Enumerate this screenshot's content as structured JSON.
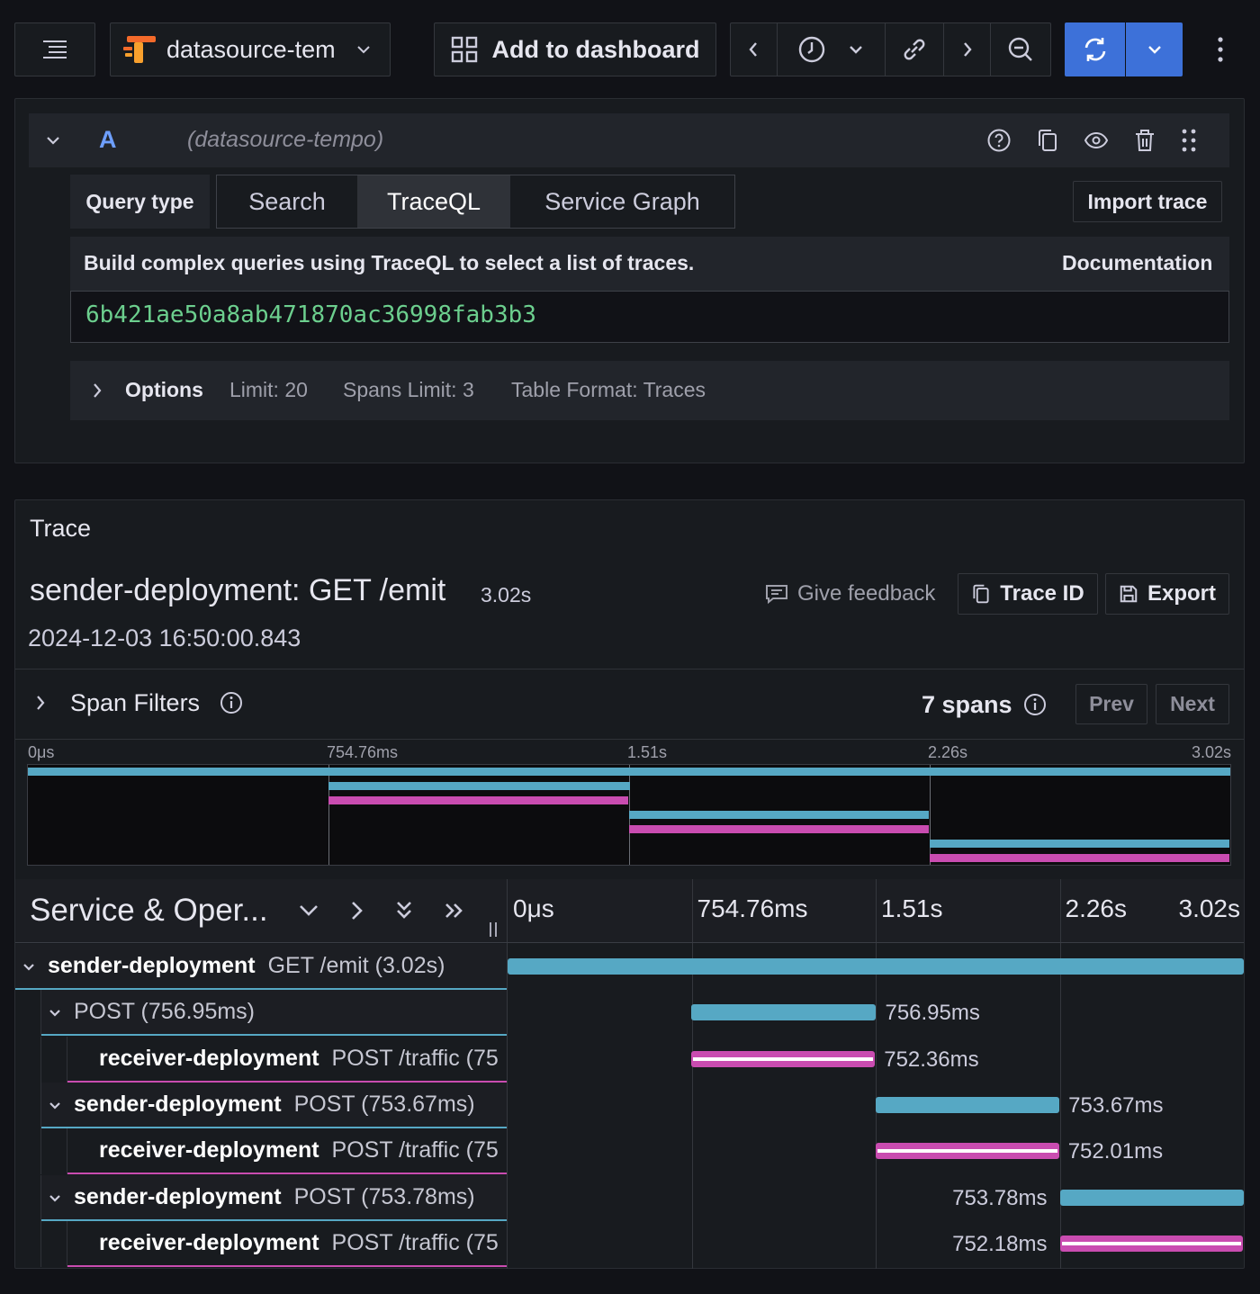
{
  "toolbar": {
    "datasource_name": "datasource-tem",
    "add_to_dashboard": "Add to dashboard"
  },
  "query": {
    "ref_id": "A",
    "datasource_label": "(datasource-tempo)",
    "query_type_label": "Query type",
    "tabs": [
      "Search",
      "TraceQL",
      "Service Graph"
    ],
    "active_tab": "TraceQL",
    "import_trace": "Import trace",
    "help_text": "Build complex queries using TraceQL to select a list of traces.",
    "documentation": "Documentation",
    "query_value": "6b421ae50a8ab471870ac36998fab3b3",
    "options_label": "Options",
    "limit": "Limit: 20",
    "spans_limit": "Spans Limit: 3",
    "table_format": "Table Format: Traces"
  },
  "trace": {
    "section_title": "Trace",
    "title": "sender-deployment: GET /emit",
    "duration": "3.02s",
    "timestamp": "2024-12-03 16:50:00.843",
    "give_feedback": "Give feedback",
    "trace_id_button": "Trace ID",
    "export_button": "Export",
    "span_filters": "Span Filters",
    "spans_count": "7 spans",
    "prev": "Prev",
    "next": "Next",
    "minimap_ticks": [
      "0μs",
      "754.76ms",
      "1.51s",
      "2.26s",
      "3.02s"
    ],
    "column_header": "Service & Oper...",
    "timeline_ticks": [
      "0μs",
      "754.76ms",
      "1.51s",
      "2.26s",
      "3.02s"
    ],
    "spans": [
      {
        "service": "sender-deployment",
        "operation": "GET /emit (3.02s)",
        "duration_label": "",
        "depth": 0,
        "start": 0,
        "duration": 3.02,
        "color": "#56a8c4",
        "expanded": true
      },
      {
        "service": "",
        "operation": "POST (756.95ms)",
        "duration_label": "756.95ms",
        "depth": 1,
        "start": 0.7548,
        "duration": 0.75695,
        "color": "#56a8c4",
        "expanded": true
      },
      {
        "service": "receiver-deployment",
        "operation": "POST /traffic (75",
        "duration_label": "752.36ms",
        "depth": 2,
        "start": 0.7548,
        "duration": 0.75236,
        "color": "#c94cb0",
        "expanded": false
      },
      {
        "service": "sender-deployment",
        "operation": "POST (753.67ms)",
        "duration_label": "753.67ms",
        "depth": 1,
        "start": 1.51,
        "duration": 0.75367,
        "color": "#56a8c4",
        "expanded": true
      },
      {
        "service": "receiver-deployment",
        "operation": "POST /traffic (75",
        "duration_label": "752.01ms",
        "depth": 2,
        "start": 1.51,
        "duration": 0.75201,
        "color": "#c94cb0",
        "expanded": false
      },
      {
        "service": "sender-deployment",
        "operation": "POST (753.78ms)",
        "duration_label": "753.78ms",
        "depth": 1,
        "start": 2.265,
        "duration": 0.75378,
        "color": "#56a8c4",
        "expanded": true
      },
      {
        "service": "receiver-deployment",
        "operation": "POST /traffic (75",
        "duration_label": "752.18ms",
        "depth": 2,
        "start": 2.265,
        "duration": 0.75218,
        "color": "#c94cb0",
        "expanded": false
      }
    ]
  },
  "colors": {
    "accent_blue": "#3d71d9",
    "span_cyan": "#56a8c4",
    "span_magenta": "#c94cb0",
    "query_green": "#6ccf8e"
  }
}
